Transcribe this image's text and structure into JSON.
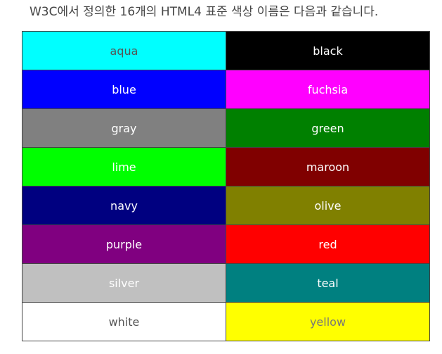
{
  "intro_text": "W3C에서 정의한 16개의 HTML4 표준 색상 이름은 다음과 같습니다.",
  "rows": [
    [
      {
        "label": "aqua",
        "bg": "#00ffff",
        "fg": "#555555"
      },
      {
        "label": "black",
        "bg": "#000000",
        "fg": "#ffffff"
      }
    ],
    [
      {
        "label": "blue",
        "bg": "#0000ff",
        "fg": "#ffffff"
      },
      {
        "label": "fuchsia",
        "bg": "#ff00ff",
        "fg": "#ffffff"
      }
    ],
    [
      {
        "label": "gray",
        "bg": "#808080",
        "fg": "#ffffff"
      },
      {
        "label": "green",
        "bg": "#008000",
        "fg": "#ffffff"
      }
    ],
    [
      {
        "label": "lime",
        "bg": "#00ff00",
        "fg": "#ffffff"
      },
      {
        "label": "maroon",
        "bg": "#800000",
        "fg": "#ffffff"
      }
    ],
    [
      {
        "label": "navy",
        "bg": "#000080",
        "fg": "#ffffff"
      },
      {
        "label": "olive",
        "bg": "#808000",
        "fg": "#ffffff"
      }
    ],
    [
      {
        "label": "purple",
        "bg": "#800080",
        "fg": "#ffffff"
      },
      {
        "label": "red",
        "bg": "#ff0000",
        "fg": "#ffffff"
      }
    ],
    [
      {
        "label": "silver",
        "bg": "#c0c0c0",
        "fg": "#ffffff"
      },
      {
        "label": "teal",
        "bg": "#008080",
        "fg": "#ffffff"
      }
    ],
    [
      {
        "label": "white",
        "bg": "#ffffff",
        "fg": "#555555"
      },
      {
        "label": "yellow",
        "bg": "#ffff00",
        "fg": "#777777"
      }
    ]
  ]
}
